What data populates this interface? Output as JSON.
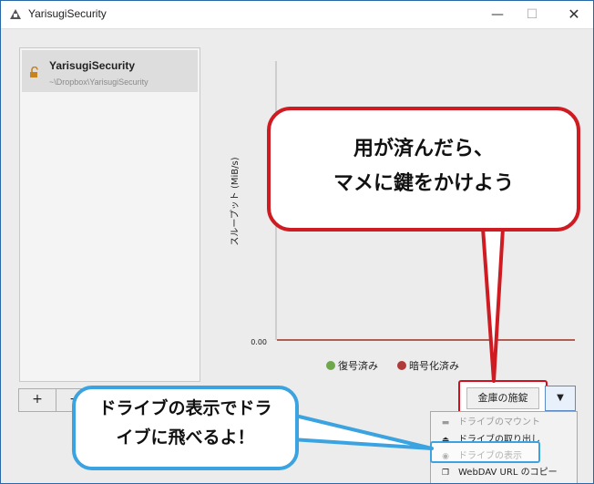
{
  "window": {
    "title": "YarisugiSecurity",
    "min_glyph": "—",
    "max_glyph": "☐",
    "close_glyph": "✕"
  },
  "vault_list": {
    "items": [
      {
        "name": "YarisugiSecurity",
        "path": "~\\Dropbox\\YarisugiSecurity",
        "icon": "unlocked-padlock-icon"
      }
    ],
    "add_label": "+",
    "remove_label": "−"
  },
  "chart_data": {
    "type": "line",
    "ylabel": "スループット (MiB/s)",
    "y_tick_labels": [
      "0.00"
    ],
    "series": [
      {
        "name": "復号済み",
        "color": "#6fa84a",
        "values": [
          0
        ]
      },
      {
        "name": "暗号化済み",
        "color": "#b03a3a",
        "values": [
          0
        ]
      }
    ],
    "legend_position": "bottom"
  },
  "actions": {
    "lock_button_label": "金庫の施錠",
    "dropdown_glyph": "▼"
  },
  "menu": {
    "items": [
      {
        "label": "ドライブのマウント",
        "icon": "folder-icon",
        "enabled": false
      },
      {
        "label": "ドライブの取り出し",
        "icon": "eject-icon",
        "enabled": true
      },
      {
        "label": "ドライブの表示",
        "icon": "eye-icon",
        "enabled": true
      },
      {
        "label": "WebDAV URL のコピー",
        "icon": "copy-icon",
        "enabled": true
      }
    ]
  },
  "callouts": {
    "top_line1": "用が済んだら、",
    "top_line2": "マメに鍵をかけよう",
    "bottom_line1": "ドライブの表示でドラ",
    "bottom_line2": "イブに飛べるよ！"
  },
  "colors": {
    "callout_red": "#cf1b22",
    "callout_blue": "#3aa3e0",
    "decrypted": "#6fa84a",
    "encrypted": "#b03a3a"
  }
}
